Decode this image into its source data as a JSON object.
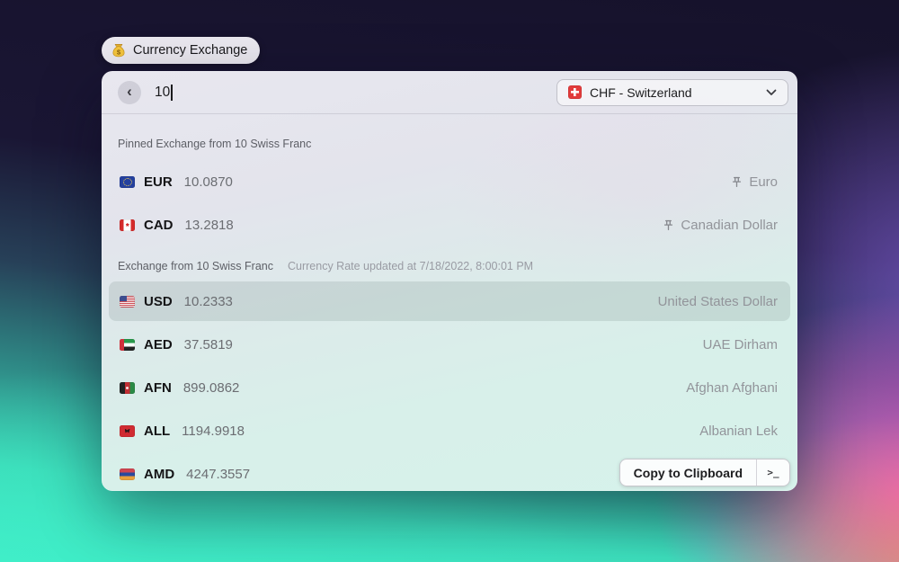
{
  "app": {
    "title": "Currency Exchange",
    "icon": "money-bag"
  },
  "search": {
    "value": "10",
    "back_icon": "chevron-left"
  },
  "currency_selector": {
    "flag": "ch",
    "label": "CHF - Switzerland",
    "icon": "chevron-down"
  },
  "sections": [
    {
      "header": "Pinned Exchange from 10 Swiss Franc",
      "note": "",
      "rows": [
        {
          "flag": "eu",
          "code": "EUR",
          "value": "10.0870",
          "name": "Euro",
          "pinned": true,
          "selected": false
        },
        {
          "flag": "ca",
          "code": "CAD",
          "value": "13.2818",
          "name": "Canadian Dollar",
          "pinned": true,
          "selected": false
        }
      ]
    },
    {
      "header": "Exchange from 10 Swiss Franc",
      "note": "Currency Rate updated at 7/18/2022, 8:00:01 PM",
      "rows": [
        {
          "flag": "us",
          "code": "USD",
          "value": "10.2333",
          "name": "United States Dollar",
          "pinned": false,
          "selected": true
        },
        {
          "flag": "ae",
          "code": "AED",
          "value": "37.5819",
          "name": "UAE Dirham",
          "pinned": false,
          "selected": false
        },
        {
          "flag": "af",
          "code": "AFN",
          "value": "899.0862",
          "name": "Afghan Afghani",
          "pinned": false,
          "selected": false
        },
        {
          "flag": "al",
          "code": "ALL",
          "value": "1194.9918",
          "name": "Albanian Lek",
          "pinned": false,
          "selected": false
        },
        {
          "flag": "am",
          "code": "AMD",
          "value": "4247.3557",
          "name": "",
          "pinned": false,
          "selected": false
        }
      ]
    }
  ],
  "actions": {
    "copy_label": "Copy to Clipboard",
    "terminal_icon": ">_"
  },
  "colors": {
    "background_top": "#19142e",
    "background_teal": "#41eec9",
    "background_pink": "#f85ac8",
    "background_purple": "#7c5ccd",
    "selected_row": "rgba(88,110,107,0.16)"
  }
}
